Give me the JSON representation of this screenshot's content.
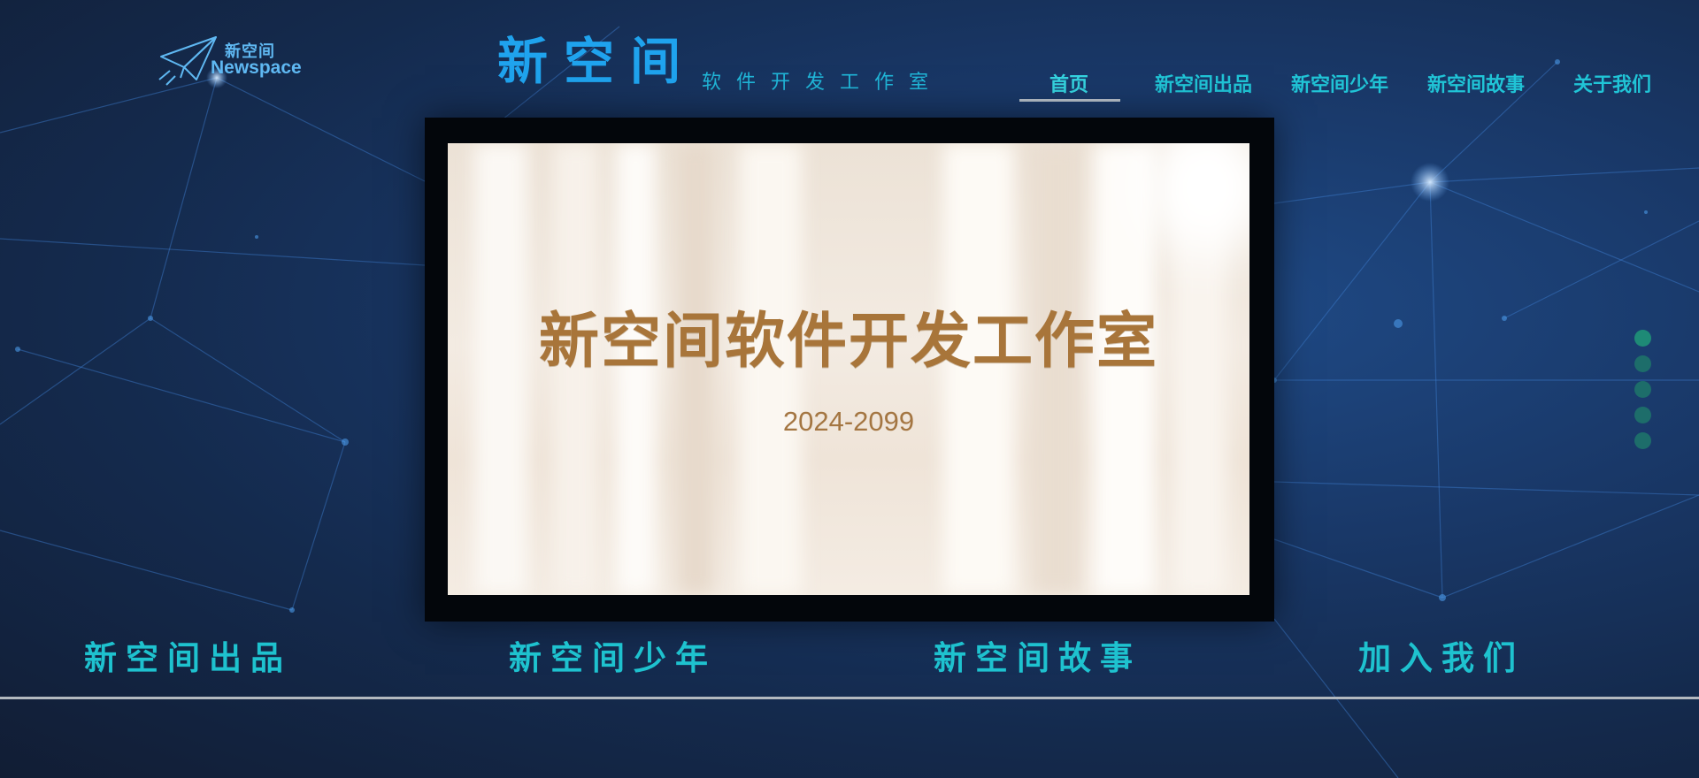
{
  "logo": {
    "cn": "新空间",
    "en": "Newspace",
    "icon": "paper-plane-icon"
  },
  "brand": {
    "title": "新空间",
    "subtitle": "软件开发工作室"
  },
  "nav": {
    "items": [
      {
        "label": "首页",
        "active": true
      },
      {
        "label": "新空间出品",
        "active": false
      },
      {
        "label": "新空间少年",
        "active": false
      },
      {
        "label": "新空间故事",
        "active": false
      },
      {
        "label": "关于我们",
        "active": false
      }
    ]
  },
  "slide": {
    "title": "新空间软件开发工作室",
    "year": "2024-2099"
  },
  "carousel": {
    "dot_count": 5,
    "active_index": 0
  },
  "bottom_nav": {
    "items": [
      {
        "label": "新空间出品"
      },
      {
        "label": "新空间少年"
      },
      {
        "label": "新空间故事"
      },
      {
        "label": "加入我们"
      }
    ]
  },
  "colors": {
    "background": "#142a4d",
    "accent": "#1fa3ee",
    "nav_text": "#20c4d6",
    "slide_title": "#a8753a",
    "dot": "#1d6d6a"
  }
}
